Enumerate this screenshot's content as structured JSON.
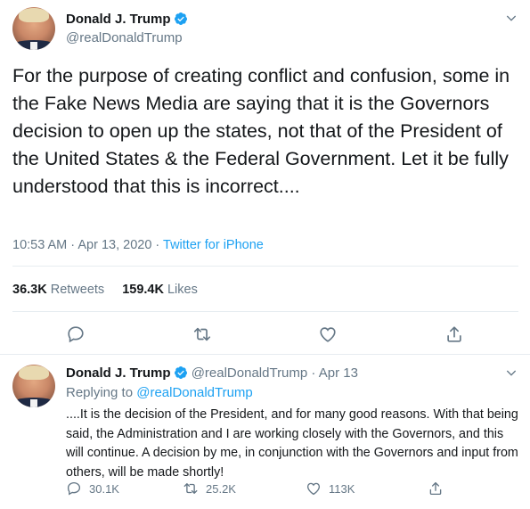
{
  "main_tweet": {
    "author_name": "Donald J. Trump",
    "handle": "@realDonaldTrump",
    "text": "For the purpose of creating conflict and confusion, some in the Fake News Media are saying that it is the Governors decision to open up the states, not that of the President of the United States & the Federal Government. Let it be fully understood that this is incorrect....",
    "timestamp": "10:53 AM · Apr 13, 2020 · ",
    "source": "Twitter for iPhone",
    "retweets_count": "36.3K",
    "retweets_label": "Retweets",
    "likes_count": "159.4K",
    "likes_label": "Likes",
    "icons": [
      "reply-icon",
      "retweet-icon",
      "like-icon",
      "share-icon"
    ]
  },
  "reply_tweet": {
    "author_name": "Donald J. Trump",
    "handle_date": "@realDonaldTrump · Apr 13",
    "replying_prefix": "Replying to ",
    "replying_to": "@realDonaldTrump",
    "text": "....It is the decision of the President, and for many good reasons. With that being said, the Administration and I are working closely with the Governors, and this will continue. A decision by me, in conjunction with the Governors and input from others, will be made shortly!",
    "reply_count": "30.1K",
    "retweet_count": "25.2K",
    "like_count": "113K"
  },
  "colors": {
    "accent": "#1da1f2",
    "text_primary": "#14171a",
    "text_secondary": "#657786",
    "divider": "#e6ecf0"
  }
}
